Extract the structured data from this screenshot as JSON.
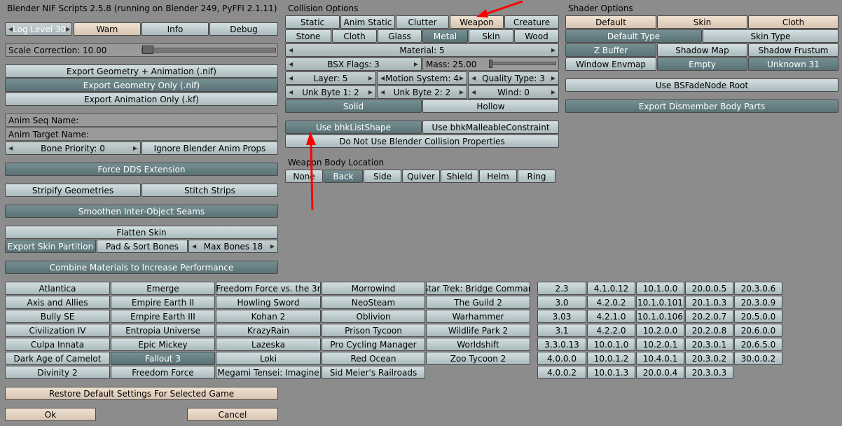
{
  "title": "Blender NIF Scripts 2.5.8 (running on Blender 249, PyFFI 2.1.11)",
  "log": {
    "level": "Log Level 30",
    "warn": "Warn",
    "info": "Info",
    "debug": "Debug"
  },
  "scale": {
    "label": "Scale Correction:  10.00",
    "value": 10.0
  },
  "export": {
    "geom_anim": "Export Geometry + Animation (.nif)",
    "geom_only": "Export Geometry Only (.nif)",
    "anim_only": "Export Animation Only (.kf)"
  },
  "anim": {
    "seq_name": "Anim Seq Name:",
    "target_name": "Anim Target Name:",
    "bone_priority": "Bone Priority: 0",
    "ignore_props": "Ignore Blender Anim Props"
  },
  "force_dds": "Force DDS Extension",
  "stripify": "Stripify Geometries",
  "stitch": "Stitch Strips",
  "smoothen": "Smoothen Inter-Object Seams",
  "flatten": "Flatten Skin",
  "skin_partition": "Export Skin Partition",
  "pad_sort": "Pad & Sort Bones",
  "max_bones": "Max Bones 18",
  "combine_materials": "Combine Materials to Increase Performance",
  "collision": {
    "header": "Collision Options",
    "row1": [
      "Static",
      "Anim Static",
      "Clutter",
      "Weapon",
      "Creature"
    ],
    "row2": [
      "Stone",
      "Cloth",
      "Glass",
      "Metal",
      "Skin",
      "Wood"
    ],
    "material": "Material:  5",
    "bsx": "BSX Flags:  3",
    "mass": "Mass:  25.00",
    "layer": "Layer:  5",
    "motion": "Motion System:  4",
    "quality": "Quality Type:  3",
    "unk1": "Unk Byte 1:  2",
    "unk2": "Unk Byte 2:  2",
    "wind": "Wind:  0",
    "solid": "Solid",
    "hollow": "Hollow",
    "bhk_list": "Use bhkListShape",
    "bhk_malleable": "Use bhkMalleableConstraint",
    "no_blender": "Do Not Use Blender Collision Properties"
  },
  "weapon_loc": {
    "header": "Weapon Body Location",
    "items": [
      "None",
      "Back",
      "Side",
      "Quiver",
      "Shield",
      "Helm",
      "Ring"
    ]
  },
  "shader": {
    "header": "Shader Options",
    "row1": [
      "Default",
      "Skin",
      "Cloth"
    ],
    "default_type": "Default Type",
    "skin_type": "Skin Type",
    "row3": [
      "Z Buffer",
      "Shadow Map",
      "Shadow Frustum"
    ],
    "row4": [
      "Window Envmap",
      "Empty",
      "Unknown 31"
    ],
    "bsfade": "Use BSFadeNode Root",
    "dismember": "Export Dismember Body Parts"
  },
  "games": [
    [
      "Atlantica",
      "Emerge",
      "Freedom Force vs. the 3r",
      "Morrowind",
      "Star Trek: Bridge Comman"
    ],
    [
      "Axis and Allies",
      "Empire Earth II",
      "Howling Sword",
      "NeoSteam",
      "The Guild 2"
    ],
    [
      "Bully SE",
      "Empire Earth III",
      "Kohan 2",
      "Oblivion",
      "Warhammer"
    ],
    [
      "Civilization IV",
      "Entropia Universe",
      "KrazyRain",
      "Prison Tycoon",
      "Wildlife Park 2"
    ],
    [
      "Culpa Innata",
      "Epic Mickey",
      "Lazeska",
      "Pro Cycling Manager",
      "Worldshift"
    ],
    [
      "Dark Age of Camelot",
      "Fallout 3",
      "Loki",
      "Red Ocean",
      "Zoo Tycoon 2"
    ],
    [
      "Divinity 2",
      "Freedom Force",
      "Megami Tensei: Imagine",
      "Sid Meier's Railroads",
      ""
    ]
  ],
  "versions": [
    [
      "2.3",
      "4.1.0.12",
      "10.1.0.0",
      "20.0.0.5",
      "20.3.0.6"
    ],
    [
      "3.0",
      "4.2.0.2",
      "10.1.0.101",
      "20.1.0.3",
      "20.3.0.9"
    ],
    [
      "3.03",
      "4.2.1.0",
      "10.1.0.106",
      "20.2.0.7",
      "20.5.0.0"
    ],
    [
      "3.1",
      "4.2.2.0",
      "10.2.0.0",
      "20.2.0.8",
      "20.6.0.0"
    ],
    [
      "3.3.0.13",
      "10.0.1.0",
      "10.2.0.1",
      "20.3.0.1",
      "20.6.5.0"
    ],
    [
      "4.0.0.0",
      "10.0.1.2",
      "10.4.0.1",
      "20.3.0.2",
      "30.0.0.2"
    ],
    [
      "4.0.0.2",
      "10.0.1.3",
      "20.0.0.4",
      "20.3.0.3",
      ""
    ]
  ],
  "restore": "Restore Default Settings For Selected Game",
  "ok": "Ok",
  "cancel": "Cancel",
  "colors": {
    "selected": "#5f777b",
    "button": "#bccacc",
    "warm": "#e4d2bf",
    "background": "#8c8c8c",
    "arrow": "#ff0000"
  }
}
